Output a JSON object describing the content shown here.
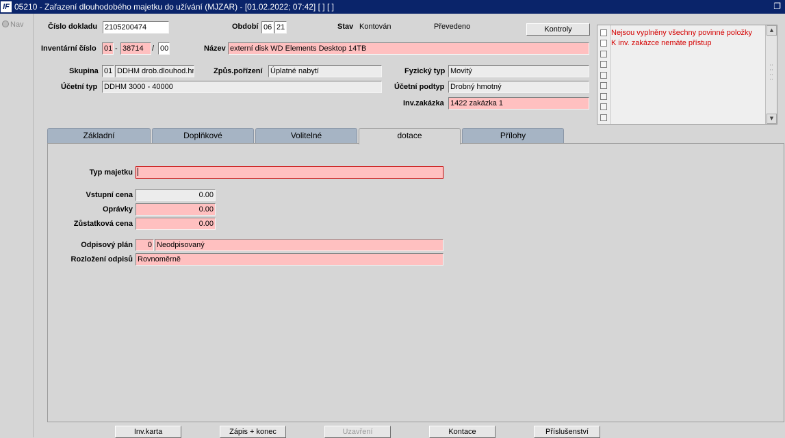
{
  "window": {
    "title": "05210 - Zařazení dlouhodobého majetku do užívání (MJZAR) - [01.02.2022; 07:42]  [ ]  [ ]",
    "logo_text": "IF",
    "restore_icon": "restore-icon"
  },
  "nav": {
    "label": "Nav"
  },
  "header": {
    "cislo_dokladu": {
      "label": "Číslo dokladu",
      "value": "2105200474"
    },
    "obdobi": {
      "label": "Období",
      "month": "06",
      "year": "21"
    },
    "stav": {
      "label": "Stav",
      "value": "Kontován",
      "value2": "Převedeno"
    },
    "kontroly_button": "Kontroly",
    "inventarni_cislo": {
      "label": "Inventární číslo",
      "part1": "01",
      "dash": "-",
      "part2": "38714",
      "slash": "/",
      "part3": "00"
    },
    "nazev": {
      "label": "Název",
      "value": "externí disk WD Elements Desktop 14TB"
    },
    "skupina": {
      "label": "Skupina",
      "code": "01",
      "value": "DDHM drob.dlouhod.hm"
    },
    "zpus_porizeni": {
      "label": "Způs.pořízení",
      "value": "Úplatné nabytí"
    },
    "fyzicky_typ": {
      "label": "Fyzický typ",
      "value": "Movitý"
    },
    "ucetni_typ": {
      "label": "Účetní typ",
      "value": "DDHM 3000 - 40000"
    },
    "ucetni_podtyp": {
      "label": "Účetní podtyp",
      "value": "Drobný hmotný"
    },
    "inv_zakazka": {
      "label": "Inv.zakázka",
      "value": "1422 zakázka 1"
    }
  },
  "messages": [
    "Nejsou vyplněny všechny povinné položky",
    "K inv. zakázce nemáte přístup"
  ],
  "tabs": [
    {
      "label": "Základní",
      "active": false
    },
    {
      "label": "Doplňkové",
      "active": false
    },
    {
      "label": "Volitelné",
      "active": false
    },
    {
      "label": "dotace",
      "active": true
    },
    {
      "label": "Přílohy",
      "active": false
    }
  ],
  "dotace": {
    "typ_majetku": {
      "label": "Typ majetku",
      "value": ""
    },
    "vstupni_cena": {
      "label": "Vstupní cena",
      "value": "0.00"
    },
    "opravky": {
      "label": "Oprávky",
      "value": "0.00"
    },
    "zustatkova_cena": {
      "label": "Zůstatková cena",
      "value": "0.00"
    },
    "odpisovy_plan": {
      "label": "Odpisový plán",
      "code": "0",
      "value": "Neodpisovaný"
    },
    "rozlozeni_odpisu": {
      "label": "Rozložení odpisů",
      "value": "Rovnoměrně"
    }
  },
  "footer_buttons": [
    {
      "label": "Inv.karta",
      "enabled": true
    },
    {
      "label": "Zápis + konec",
      "enabled": true
    },
    {
      "label": "Uzavření",
      "enabled": false
    },
    {
      "label": "Kontace",
      "enabled": true
    },
    {
      "label": "Příslušenství",
      "enabled": true
    }
  ],
  "colors": {
    "title_bar": "#0a246a",
    "required_field": "#ffc0c0",
    "readonly_field": "#ececec",
    "message_text": "#d40000",
    "tab": "#a6b4c4"
  }
}
